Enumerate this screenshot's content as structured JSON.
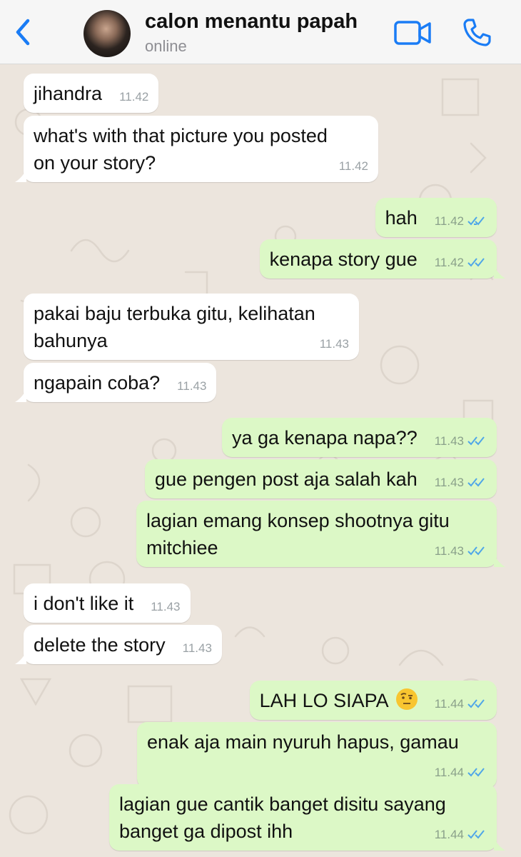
{
  "header": {
    "contact_name": "calon menantu papah",
    "status": "online",
    "back_icon": "chevron-left-icon",
    "video_icon": "video-camera-icon",
    "call_icon": "phone-icon",
    "accent_color": "#1a7cf5"
  },
  "messages": [
    {
      "direction": "in",
      "text": "jihandra",
      "time": "11.42"
    },
    {
      "direction": "in",
      "text": "what's with that picture you posted\non your story?",
      "time": "11.42"
    },
    {
      "direction": "out",
      "text": "hah",
      "time": "11.42"
    },
    {
      "direction": "out",
      "text": "kenapa story gue",
      "time": "11.42"
    },
    {
      "direction": "in",
      "text": "pakai baju terbuka gitu, kelihatan\nbahunya",
      "time": "11.43"
    },
    {
      "direction": "in",
      "text": "ngapain coba?",
      "time": "11.43"
    },
    {
      "direction": "out",
      "text": "ya ga kenapa napa??",
      "time": "11.43"
    },
    {
      "direction": "out",
      "text": "gue pengen post aja salah kah",
      "time": "11.43"
    },
    {
      "direction": "out",
      "text": "lagian emang konsep shootnya gitu\nmitchiee",
      "time": "11.43"
    },
    {
      "direction": "in",
      "text": "i don't like it",
      "time": "11.43"
    },
    {
      "direction": "in",
      "text": "delete the story",
      "time": "11.43"
    },
    {
      "direction": "out",
      "text": "LAH LO SIAPA",
      "emoji": "face-with-raised-eyebrow",
      "time": "11.44"
    },
    {
      "direction": "out",
      "text": "enak aja main nyuruh hapus, gamau",
      "time": "11.44"
    },
    {
      "direction": "out",
      "text": "lagian gue cantik banget disitu sayang\nbanget ga dipost ihh",
      "time": "11.44"
    }
  ],
  "colors": {
    "incoming_bubble": "#ffffff",
    "outgoing_bubble": "#dcf8c6",
    "read_ticks": "#4fa6e8",
    "wallpaper": "#ece5dd"
  }
}
